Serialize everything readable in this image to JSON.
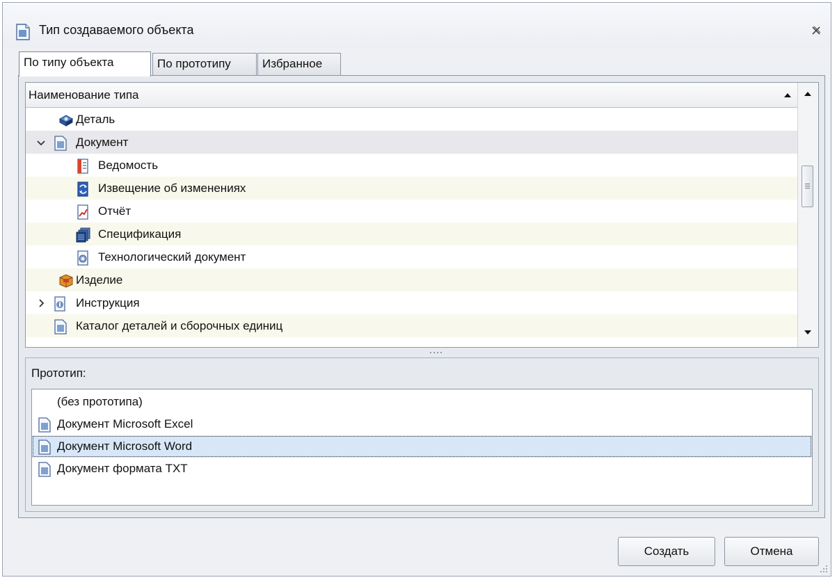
{
  "window": {
    "title": "Тип создаваемого объекта"
  },
  "tabs": [
    {
      "label": "По типу объекта",
      "active": true
    },
    {
      "label": "По прототипу",
      "active": false
    },
    {
      "label": "Избранное",
      "active": false
    }
  ],
  "tree": {
    "column_header": "Наименование типа",
    "rows": [
      {
        "label": "Деталь",
        "icon": "detail-icon",
        "level": 0,
        "expander": "none"
      },
      {
        "label": "Документ",
        "icon": "document-icon",
        "level": 0,
        "expander": "expanded"
      },
      {
        "label": "Ведомость",
        "icon": "statement-icon",
        "level": 1,
        "expander": "none"
      },
      {
        "label": "Извещение об изменениях",
        "icon": "change-notice-icon",
        "level": 1,
        "expander": "none"
      },
      {
        "label": "Отчёт",
        "icon": "report-icon",
        "level": 1,
        "expander": "none"
      },
      {
        "label": "Спецификация",
        "icon": "specification-icon",
        "level": 1,
        "expander": "none"
      },
      {
        "label": "Технологический документ",
        "icon": "tech-document-icon",
        "level": 1,
        "expander": "none"
      },
      {
        "label": "Изделие",
        "icon": "product-icon",
        "level": 0,
        "expander": "none"
      },
      {
        "label": "Инструкция",
        "icon": "instruction-icon",
        "level": 0,
        "expander": "collapsed"
      },
      {
        "label": "Каталог деталей и сборочных единиц",
        "icon": "document-icon",
        "level": 0,
        "expander": "none"
      }
    ]
  },
  "prototype": {
    "label": "Прототип:",
    "items": [
      {
        "label": "(без прототипа)",
        "icon": "",
        "selected": false
      },
      {
        "label": "Документ Microsoft Excel",
        "icon": "document-icon",
        "selected": false
      },
      {
        "label": "Документ Microsoft Word",
        "icon": "document-icon",
        "selected": true
      },
      {
        "label": "Документ формата TXT",
        "icon": "document-icon",
        "selected": false
      }
    ]
  },
  "buttons": {
    "create": "Создать",
    "cancel": "Отмена"
  },
  "colors": {
    "row_alt": "#f8f8ec",
    "row_highlight": "#e7e7ec",
    "selection": "#d7e7f8"
  }
}
